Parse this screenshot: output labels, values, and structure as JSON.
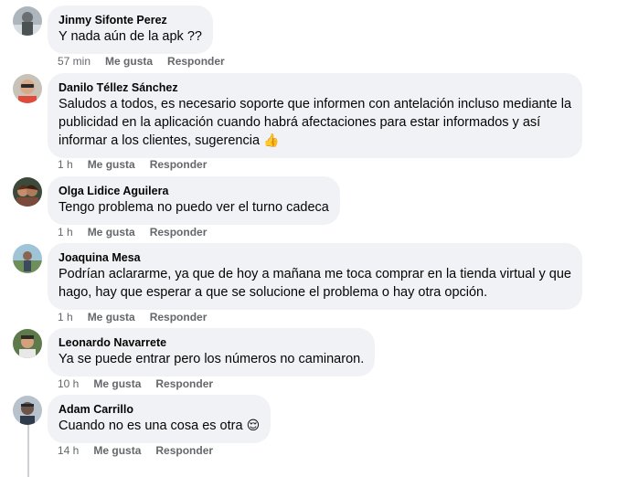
{
  "comments": [
    {
      "author": "Jinmy Sifonte Perez",
      "text": "Y nada aún de la apk ??",
      "time": "57 min",
      "like": "Me gusta",
      "reply": "Responder"
    },
    {
      "author": "Danilo Téllez Sánchez",
      "text": "Saludos a todos, es necesario soporte que informen con antelación incluso mediante la\npublicidad en la aplicación cuando habrá afectaciones para estar informados y así\ninformar a los clientes, sugerencia",
      "emoji": "👍",
      "time": "1 h",
      "like": "Me gusta",
      "reply": "Responder"
    },
    {
      "author": "Olga Lidice Aguilera",
      "text": "Tengo problema no puedo ver el turno cadeca",
      "time": "1 h",
      "like": "Me gusta",
      "reply": "Responder"
    },
    {
      "author": "Joaquina Mesa",
      "text": "Podrían aclararme, ya que de hoy a mañana me toca comprar en la tienda virtual y que\nhago, hay que esperar a que se solucione el problema o hay otra opción.",
      "time": "1 h",
      "like": "Me gusta",
      "reply": "Responder"
    },
    {
      "author": "Leonardo Navarrete",
      "text": "Ya se puede entrar pero los números no caminaron.",
      "time": "10 h",
      "like": "Me gusta",
      "reply": "Responder"
    },
    {
      "author": "Adam Carrillo",
      "text": "Cuando no es una cosa es otra",
      "emoji": "😌",
      "time": "14 h",
      "like": "Me gusta",
      "reply": "Responder"
    }
  ],
  "colors": {
    "bubble": "#f0f2f5",
    "meta_text": "#65676b",
    "body_text": "#050505",
    "thread_line": "#ced0d4"
  }
}
